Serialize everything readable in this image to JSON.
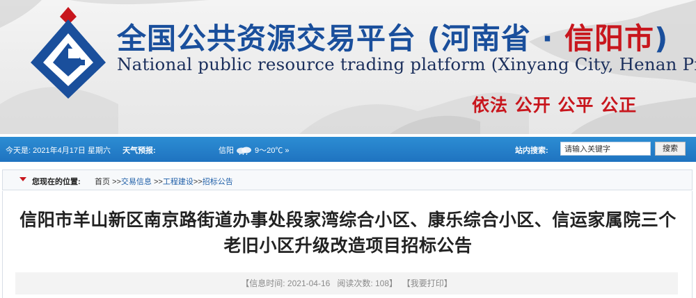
{
  "header": {
    "title_cn": "全国公共资源交易平台",
    "region_open": "(河南省 · ",
    "city": "信阳市",
    "region_close": ")",
    "title_en": "National public resource trading platform (Xinyang City, Henan Province)",
    "slogan": "依法 公开 公平 公正",
    "colors": {
      "brand_blue": "#1a4f9c",
      "brand_red": "#c8161d"
    }
  },
  "infobar": {
    "date_text": "今天是: 2021年4月17日  星期六",
    "weather_label": "天气预报:",
    "city": "信阳",
    "weather_icon": "cloud-rain-icon",
    "temperature": "9～20℃",
    "weather_more": "»",
    "search_label": "站内搜索:",
    "search_placeholder": "请输入关键字",
    "search_button": "搜索",
    "colors": {
      "bar": "#1f73c0"
    }
  },
  "breadcrumb": {
    "label": "您现在的位置:",
    "home": "首页",
    "sep": ">>",
    "items": [
      "交易信息",
      "工程建设",
      "招标公告"
    ]
  },
  "article": {
    "title": "信阳市羊山新区南京路街道办事处段家湾综合小区、康乐综合小区、信运家属院三个老旧小区升级改造项目招标公告",
    "meta_time_label": "【信息时间: ",
    "meta_time": "2021-04-16",
    "meta_views_label": "阅读次数: ",
    "meta_views": "108",
    "meta_close": "】",
    "print": "【我要打印】"
  }
}
